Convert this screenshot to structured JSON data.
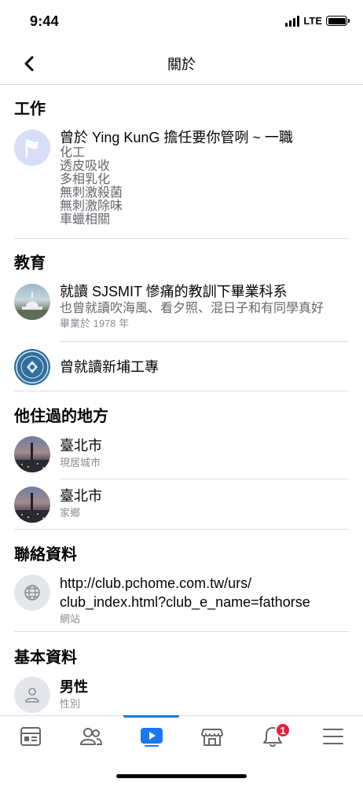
{
  "status": {
    "time": "9:44",
    "network": "LTE"
  },
  "nav": {
    "title": "關於"
  },
  "work": {
    "section_title": "工作",
    "headline": "曾於 Ying KunG 擔任要你管咧 ~ 一職",
    "details": [
      "化工",
      "透皮吸收",
      "多相乳化",
      "無刺激殺菌",
      "無刺激除味",
      "車蠟相關"
    ]
  },
  "education": {
    "section_title": "教育",
    "items": [
      {
        "title": "就讀 SJSMIT 慘痛的教訓下畢業科系",
        "detail": "也曾就讀吹海風、看夕照、混日子和有同學真好",
        "sub": "畢業於 1978 年"
      },
      {
        "title": "曾就讀新埔工專"
      }
    ]
  },
  "places": {
    "section_title": "他住過的地方",
    "items": [
      {
        "title": "臺北市",
        "sub": "現居城市"
      },
      {
        "title": "臺北市",
        "sub": "家鄉"
      }
    ]
  },
  "contact": {
    "section_title": "聯絡資料",
    "url_line1": "http://club.pchome.com.tw/urs/",
    "url_line2": "club_index.html?club_e_name=fathorse",
    "sub": "網站"
  },
  "basic": {
    "section_title": "基本資料",
    "gender": "男性",
    "sub": "性別"
  },
  "tabs": [
    {
      "icon": "news-feed-icon"
    },
    {
      "icon": "friends-icon"
    },
    {
      "icon": "watch-icon",
      "active": true
    },
    {
      "icon": "marketplace-icon"
    },
    {
      "icon": "notifications-icon",
      "badge": "1"
    },
    {
      "icon": "menu-icon"
    }
  ],
  "colors": {
    "accent": "#1877f2",
    "badge": "#e41e3f",
    "divider": "#dadde1",
    "secondary_text": "#65676b"
  }
}
